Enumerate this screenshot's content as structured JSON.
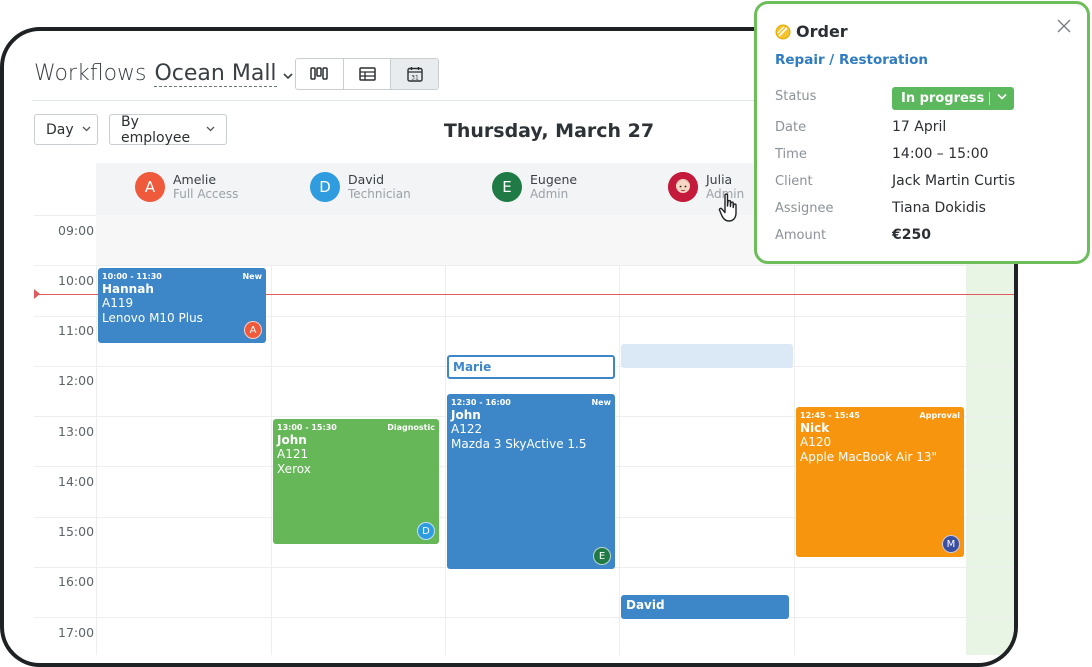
{
  "header": {
    "title_prefix": "Workflows",
    "location": "Ocean Mall",
    "location_caret": "⌄",
    "views": [
      {
        "name": "kanban-view-icon"
      },
      {
        "name": "table-view-icon"
      },
      {
        "name": "calendar-view-icon",
        "label": "31",
        "active": true
      }
    ]
  },
  "toolbar": {
    "range_label": "Day",
    "group_label": "By employee",
    "date_title": "Thursday, March 27"
  },
  "employees": [
    {
      "initial": "A",
      "name": "Amelie",
      "role": "Full Access",
      "color": "#ef5a3c"
    },
    {
      "initial": "D",
      "name": "David",
      "role": "Technician",
      "color": "#2f9ce0"
    },
    {
      "initial": "E",
      "name": "Eugene",
      "role": "Admin",
      "color": "#1f7a45"
    },
    {
      "initial": "",
      "name": "Julia",
      "role": "Admin",
      "color": "#c41a3c"
    }
  ],
  "times": [
    "09:00",
    "10:00",
    "11:00",
    "12:00",
    "13:00",
    "14:00",
    "15:00",
    "16:00",
    "17:00"
  ],
  "events": [
    {
      "time": "10:00 - 11:30",
      "tag": "New",
      "client": "Hannah",
      "code": "A119",
      "device": "Lenovo M10 Plus",
      "assignee": "A",
      "assignee_color": "#ef5a3c",
      "color": "blue"
    },
    {
      "time": "13:00 - 15:30",
      "tag": "Diagnostic",
      "client": "John",
      "code": "A121",
      "device": "Xerox",
      "assignee": "D",
      "assignee_color": "#2f9ce0",
      "color": "green"
    },
    {
      "time": "12:30 - 16:00",
      "tag": "New",
      "client": "John",
      "code": "A122",
      "device": "Mazda 3 SkyActive 1.5",
      "assignee": "E",
      "assignee_color": "#1f7a45",
      "color": "blue"
    },
    {
      "time": "12:45 - 15:45",
      "tag": "Approval",
      "client": "Nick",
      "code": "A120",
      "device": "Apple MacBook Air 13\"",
      "assignee": "M",
      "assignee_color": "#3b4fa0",
      "color": "orange"
    }
  ],
  "outline_event": {
    "label": "Marie"
  },
  "bottom_event": {
    "label": "David"
  },
  "popup": {
    "title": "Order",
    "subtitle": "Repair / Restoration",
    "status_label": "Status",
    "status_value": "In progress",
    "date_label": "Date",
    "date_value": "17 April",
    "time_label": "Time",
    "time_value": "14:00 – 15:00",
    "client_label": "Client",
    "client_value": "Jack Martin Curtis",
    "assignee_label": "Assignee",
    "assignee_value": "Tiana Dokidis",
    "amount_label": "Amount",
    "amount_value": "€250",
    "accent_color": "#6dbd5a",
    "status_color": "#5cb85c"
  }
}
